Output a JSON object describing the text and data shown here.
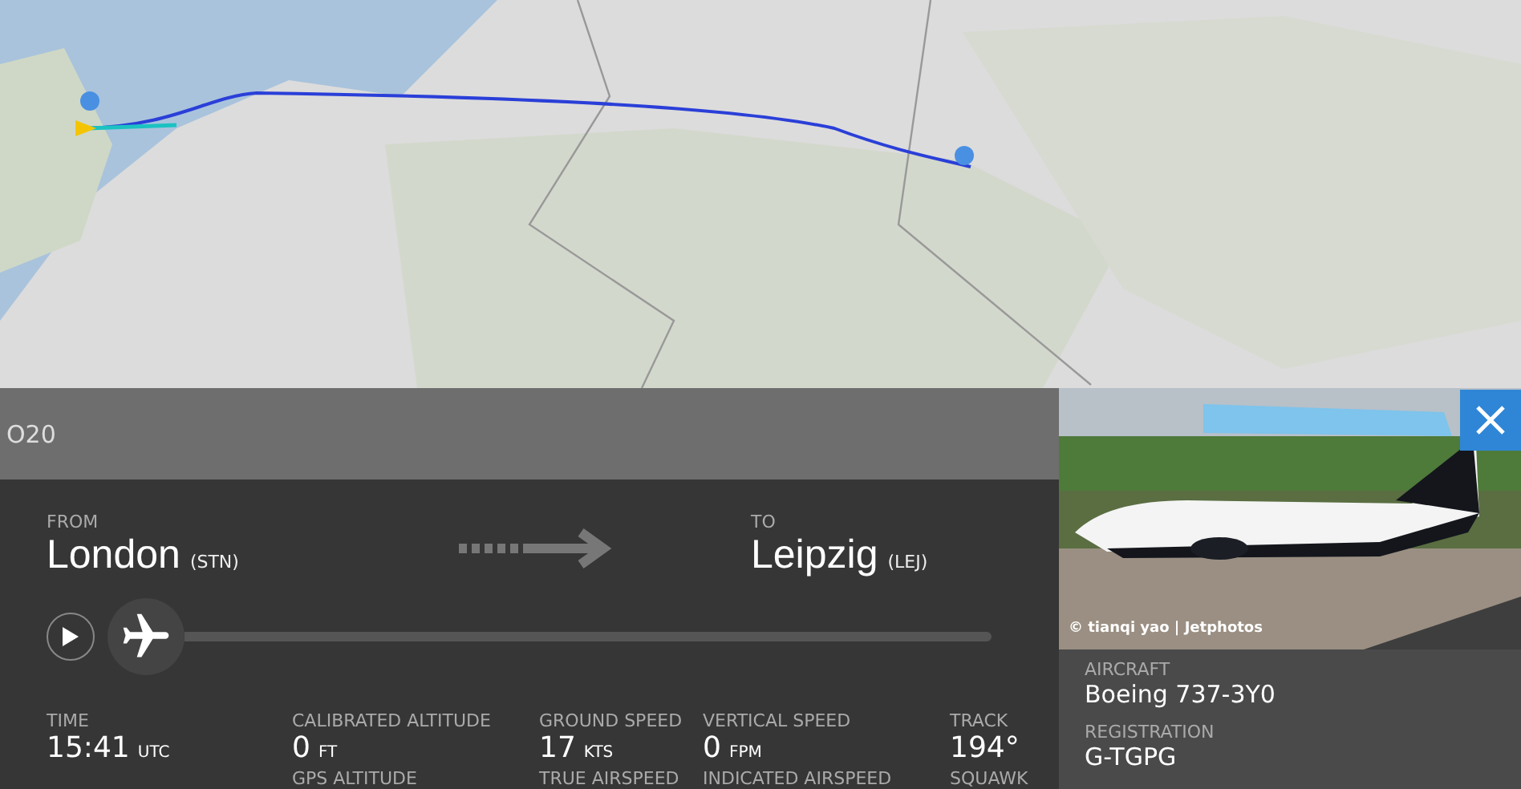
{
  "flight_header": {
    "callsign": "O20"
  },
  "route": {
    "from": {
      "label": "FROM",
      "city": "London",
      "code": "(STN)"
    },
    "to": {
      "label": "TO",
      "city": "Leipzig",
      "code": "(LEJ)"
    }
  },
  "progress": {
    "level": 0.0
  },
  "stats": [
    {
      "label": "TIME",
      "value": "15:41",
      "unit": "UTC"
    },
    {
      "label": "CALIBRATED ALTITUDE",
      "value": "0",
      "unit": "FT"
    },
    {
      "label": "GROUND SPEED",
      "value": "17",
      "unit": "KTS"
    },
    {
      "label": "VERTICAL SPEED",
      "value": "0",
      "unit": "FPM"
    },
    {
      "label": "TRACK",
      "value": "194°"
    }
  ],
  "stats_next": [
    "GPS ALTITUDE",
    "TRUE AIRSPEED",
    "INDICATED AIRSPEED",
    "SQUAWK"
  ],
  "photo": {
    "kind": "picture",
    "credit": "© tianqi yao | Jetphotos"
  },
  "aircraft_info": [
    {
      "label": "AIRCRAFT",
      "value": "Boeing 737-3Y0"
    },
    {
      "label": "REGISTRATION",
      "value": "G-TGPG"
    }
  ]
}
